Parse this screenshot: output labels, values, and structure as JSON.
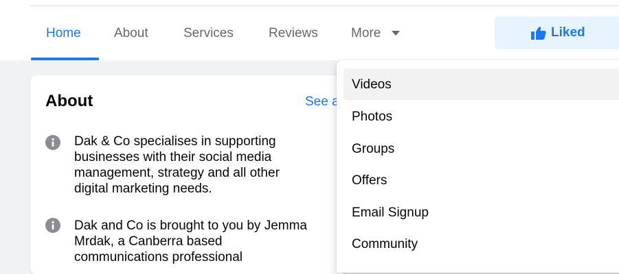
{
  "nav": {
    "tabs": [
      {
        "label": "Home",
        "active": true
      },
      {
        "label": "About",
        "active": false
      },
      {
        "label": "Services",
        "active": false
      },
      {
        "label": "Reviews",
        "active": false
      },
      {
        "label": "More",
        "active": false
      }
    ],
    "liked_label": "Liked",
    "accent_color": "#1877f2",
    "liked_bg_color": "#e7f3ff"
  },
  "about": {
    "title": "About",
    "see_all_label": "See a",
    "items": [
      {
        "icon": "info-icon",
        "lines": [
          "Dak & Co specialises in supporting",
          "businesses with their social media",
          "management, strategy and all other",
          "digital marketing needs."
        ]
      },
      {
        "icon": "info-icon",
        "lines": [
          "Dak and Co is brought to you by Jemma",
          "Mrdak, a Canberra based",
          "communications professional"
        ]
      }
    ]
  },
  "more_menu": {
    "items": [
      {
        "label": "Videos",
        "highlighted": true
      },
      {
        "label": "Photos",
        "highlighted": false
      },
      {
        "label": "Groups",
        "highlighted": false
      },
      {
        "label": "Offers",
        "highlighted": false
      },
      {
        "label": "Email Signup",
        "highlighted": false
      },
      {
        "label": "Community",
        "highlighted": false
      }
    ]
  }
}
